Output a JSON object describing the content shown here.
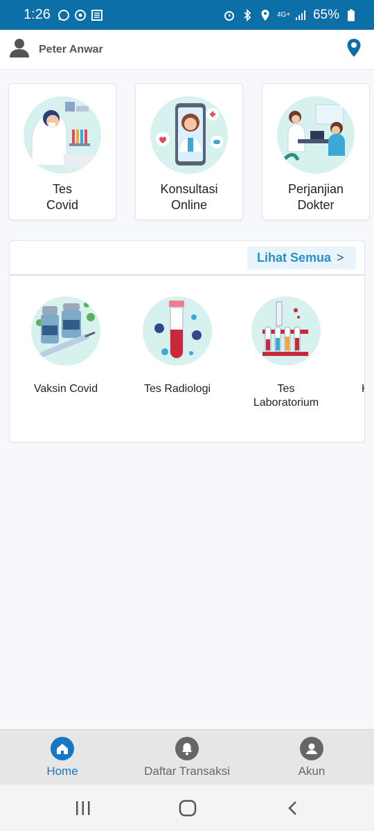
{
  "status_bar": {
    "time": "1:26",
    "battery": "65%",
    "network": "4G+"
  },
  "header": {
    "user_name": "Peter Anwar"
  },
  "feature_cards": [
    {
      "label": "Tes\nCovid"
    },
    {
      "label": "Konsultasi\nOnline"
    },
    {
      "label": "Perjanjian\nDokter"
    }
  ],
  "services_panel": {
    "see_all": "Lihat Semua",
    "see_all_arrow": ">",
    "items": [
      {
        "label": "Vaksin Covid"
      },
      {
        "label": "Tes Radiologi"
      },
      {
        "label": "Tes\nLaboratorium"
      },
      {
        "label": "K"
      }
    ]
  },
  "bottom_nav": {
    "items": [
      {
        "label": "Home",
        "active": true
      },
      {
        "label": "Daftar Transaksi",
        "active": false
      },
      {
        "label": "Akun",
        "active": false
      }
    ]
  },
  "colors": {
    "primary": "#0d6fa8",
    "active_nav": "#1877c2",
    "inactive_nav": "#666666",
    "link": "#2a8ec9",
    "thumb_bg": "#d6f1ee"
  }
}
